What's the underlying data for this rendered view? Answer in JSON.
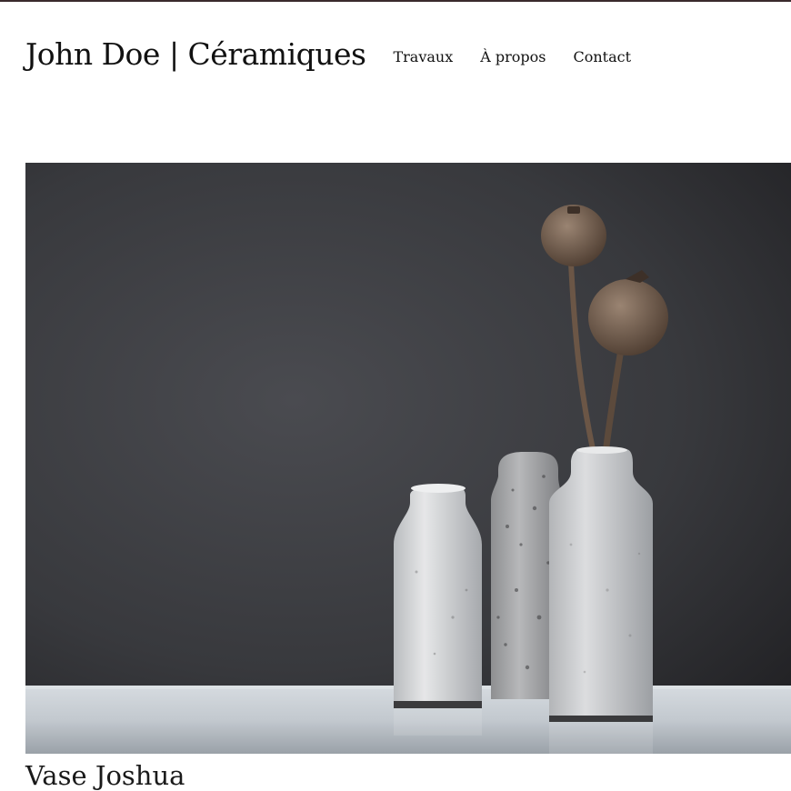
{
  "site": {
    "title": "John Doe | Céramiques"
  },
  "nav": {
    "items": [
      {
        "label": "Travaux"
      },
      {
        "label": "À propos"
      },
      {
        "label": "Contact"
      }
    ]
  },
  "hero": {
    "caption": "Vase Joshua"
  },
  "colors": {
    "top_border": "#3a2a2c",
    "wall": "#2f2f33",
    "table": "#c9ced3",
    "ceramic": "#d9dbdd"
  }
}
